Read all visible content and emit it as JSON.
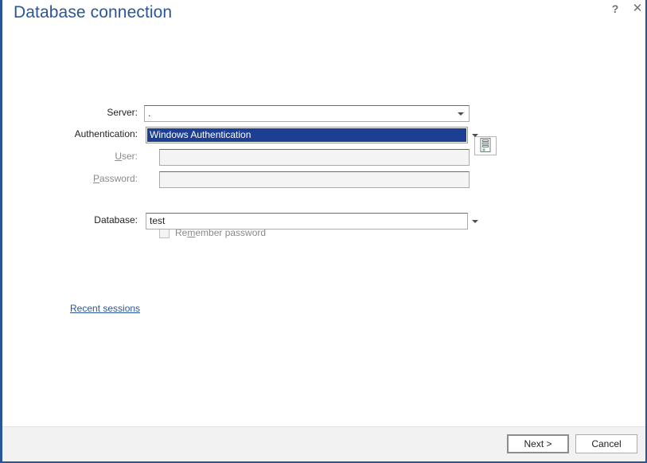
{
  "window": {
    "title": "Database connection",
    "accent_color": "#2a5699",
    "border_color": "#2a5699"
  },
  "titlebar": {
    "help_glyph": "?",
    "close_glyph": "✕",
    "help_name": "help-button",
    "close_name": "close-button"
  },
  "form": {
    "server": {
      "label": "Server:",
      "value": ".",
      "placeholder": "",
      "browse_icon": "server-tower-icon"
    },
    "authentication": {
      "label": "Authentication:",
      "value": "Windows Authentication",
      "selected": true,
      "highlight_color": "#1c3f94",
      "highlight_text_color": "#ffffff"
    },
    "user": {
      "label_prefix": "",
      "label_accesskey": "U",
      "label_suffix": "ser:",
      "label": "User:",
      "value": "",
      "placeholder": "",
      "disabled": true
    },
    "password": {
      "label_accesskey": "P",
      "label_suffix": "assword:",
      "label": "Password:",
      "value": "",
      "placeholder": "",
      "disabled": true
    },
    "remember_password": {
      "label_prefix": "Re",
      "label_accesskey": "m",
      "label_suffix": "ember password",
      "label": "Remember password",
      "checked": false,
      "disabled": true
    },
    "database": {
      "label": "Database:",
      "value": "test",
      "placeholder": ""
    },
    "recent_sessions_link": "Recent sessions"
  },
  "footer": {
    "next_label": "Next >",
    "cancel_label": "Cancel"
  }
}
